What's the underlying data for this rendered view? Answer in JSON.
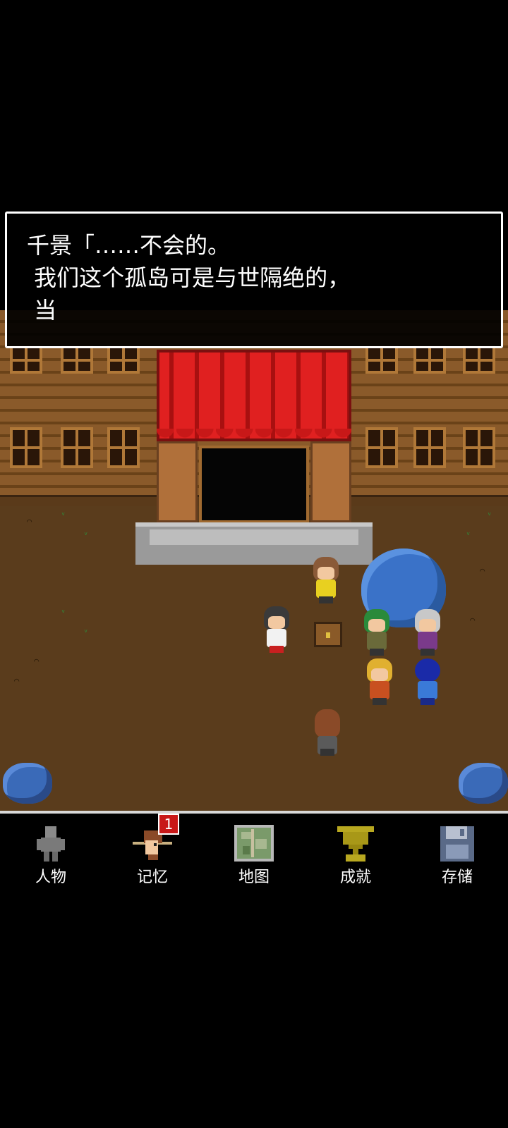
{
  "dialogue": {
    "line1": "千景「……不会的。",
    "line2": " 我们这个孤岛可是与世隔绝的，",
    "line3": " 当"
  },
  "menu": {
    "items": [
      {
        "label": "人物",
        "icon": "person-icon"
      },
      {
        "label": "记忆",
        "icon": "memory-icon",
        "badge": "1"
      },
      {
        "label": "地图",
        "icon": "map-icon"
      },
      {
        "label": "成就",
        "icon": "trophy-icon"
      },
      {
        "label": "存储",
        "icon": "save-disk-icon"
      }
    ]
  },
  "colors": {
    "menu_border": "#d8d8d8",
    "badge": "#c81818",
    "curtain": "#c81818",
    "tree": "#3a72c8"
  }
}
